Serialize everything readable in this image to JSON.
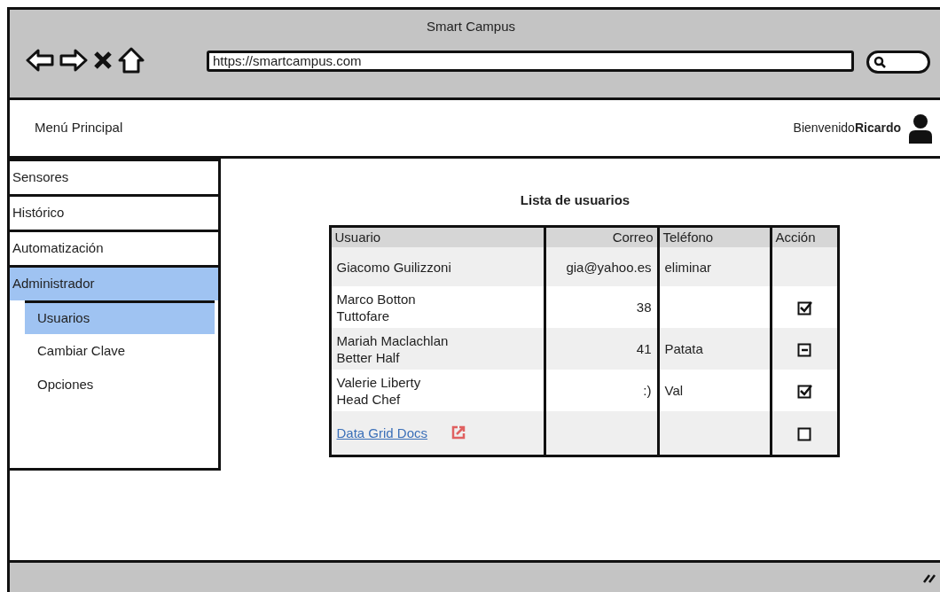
{
  "window": {
    "title": "Smart Campus",
    "url": "https://smartcampus.com"
  },
  "header": {
    "menu_title": "Menú Principal",
    "greeting": "Bienvenido",
    "user": "Ricardo"
  },
  "sidebar": {
    "items": [
      {
        "label": "Sensores",
        "selected": false
      },
      {
        "label": "Histórico",
        "selected": false
      },
      {
        "label": "Automatización",
        "selected": false
      },
      {
        "label": "Administrador",
        "selected": true,
        "children": [
          {
            "label": "Usuarios",
            "selected": true
          },
          {
            "label": "Cambiar Clave",
            "selected": false
          },
          {
            "label": "Opciones",
            "selected": false
          }
        ]
      }
    ]
  },
  "content": {
    "title": "Lista de usuarios",
    "table": {
      "columns": [
        "Usuario",
        "Correo",
        "Teléfono",
        "Acción"
      ],
      "rows": [
        {
          "kind": "text",
          "usuario": "Giacomo Guilizzoni",
          "correo": "gia@yahoo.es",
          "telefono": "eliminar"
        },
        {
          "kind": "text",
          "usuario": "Marco Botton\nTuttofare",
          "correo": "38",
          "checked": true,
          "indeterminate": false
        },
        {
          "kind": "text",
          "usuario": "Mariah Maclachlan\nBetter Half",
          "correo": "41",
          "telefono": "Patata",
          "checked": false,
          "indeterminate": true
        },
        {
          "kind": "text",
          "usuario": "Valerie Liberty\nHead Chef",
          "correo": ":)",
          "telefono": "Val",
          "checked": true,
          "indeterminate": false
        },
        {
          "kind": "link",
          "usuario": "Data Grid Docs",
          "checked": false,
          "indeterminate": false
        }
      ]
    }
  }
}
